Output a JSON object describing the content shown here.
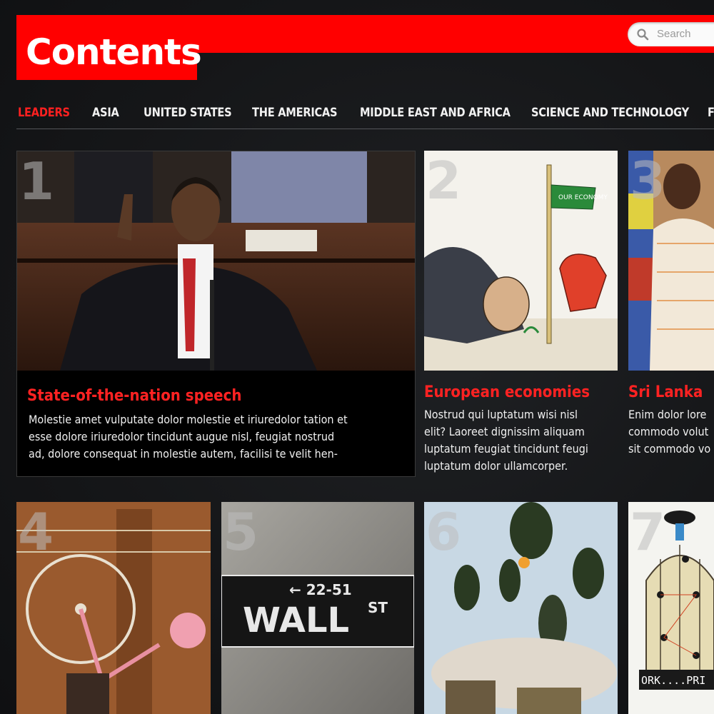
{
  "header": {
    "title": "Contents",
    "search_placeholder": "Search",
    "brand_color": "#ff0000"
  },
  "nav": {
    "items": [
      {
        "label": "LEADERS",
        "active": true
      },
      {
        "label": "ASIA",
        "active": false
      },
      {
        "label": "UNITED STATES",
        "active": false
      },
      {
        "label": "THE AMERICAS",
        "active": false
      },
      {
        "label": "MIDDLE EAST AND AFRICA",
        "active": false
      },
      {
        "label": "SCIENCE AND TECHNOLOGY",
        "active": false
      },
      {
        "label": "F",
        "active": false
      }
    ]
  },
  "articles": [
    {
      "number": "1",
      "headline": "State-of-the-nation speech",
      "summary_lines": [
        "Molestie amet vulputate dolor molestie et iriuredolor tation et",
        "esse dolore iriuredolor tincidunt augue nisl, feugiat nostrud",
        "ad, dolore consequat in molestie autem, facilisi te velit hen-"
      ]
    },
    {
      "number": "2",
      "headline": "European economies",
      "flag_text": "OUR ECONOMY",
      "summary_lines": [
        "Nostrud qui luptatum wisi nisl",
        "elit? Laoreet dignissim aliquam",
        "luptatum feugiat tincidunt feugi",
        "luptatum dolor ullamcorper."
      ]
    },
    {
      "number": "3",
      "headline": "Sri Lanka",
      "summary_lines": [
        "Enim dolor lore",
        "commodo volut",
        "sit commodo vo"
      ]
    },
    {
      "number": "4"
    },
    {
      "number": "5",
      "sign_arrow": "← 22-51",
      "sign_main": "WALL",
      "sign_suffix": "ST"
    },
    {
      "number": "6"
    },
    {
      "number": "7",
      "caption": "ORK....PRI"
    }
  ],
  "icons": {
    "search": "search-icon"
  }
}
